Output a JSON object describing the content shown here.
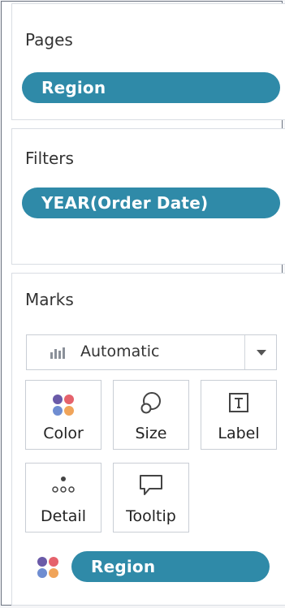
{
  "pages": {
    "title": "Pages",
    "pill": "Region"
  },
  "filters": {
    "title": "Filters",
    "pill": "YEAR(Order Date)"
  },
  "marks": {
    "title": "Marks",
    "mark_type": {
      "selected": "Automatic",
      "icon": "bar-chart-icon"
    },
    "cards": [
      {
        "label": "Color",
        "icon": "color-dots-icon"
      },
      {
        "label": "Size",
        "icon": "size-circle-icon"
      },
      {
        "label": "Label",
        "icon": "text-box-icon"
      },
      {
        "label": "Detail",
        "icon": "detail-dots-icon"
      },
      {
        "label": "Tooltip",
        "icon": "speech-bubble-icon"
      }
    ],
    "color_field": "Region"
  },
  "colors": {
    "pill": "#2f8aa8",
    "dot_purple": "#6a5aa8",
    "dot_red": "#e5626c",
    "dot_blue": "#6f8dd1",
    "dot_orange": "#f0a45a"
  }
}
